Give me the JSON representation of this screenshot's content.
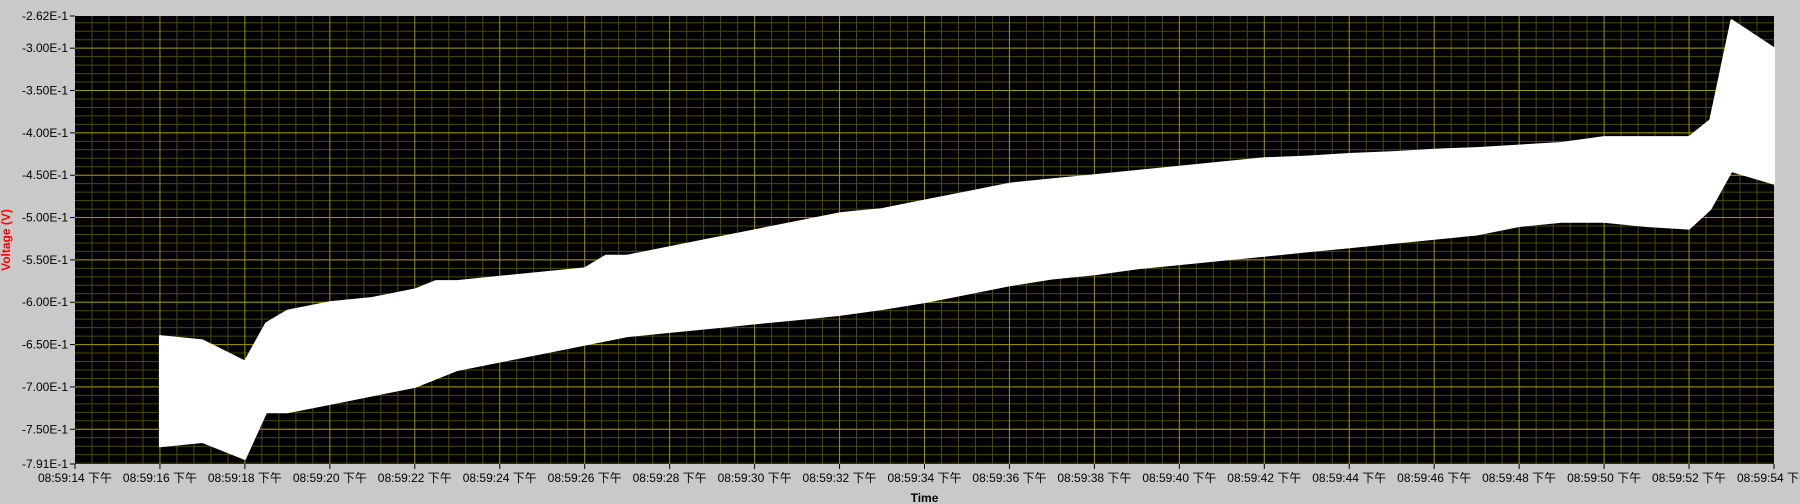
{
  "chart_data": {
    "type": "area",
    "title": "",
    "xlabel": "Time",
    "ylabel": "Voltage (V)",
    "ylim": [
      -0.791,
      -0.262
    ],
    "y_ticks": [
      -0.262,
      -0.3,
      -0.35,
      -0.4,
      -0.45,
      -0.5,
      -0.55,
      -0.6,
      -0.65,
      -0.7,
      -0.75,
      -0.791
    ],
    "y_tick_labels": [
      "-2.62E-1",
      "-3.00E-1",
      "-3.50E-1",
      "-4.00E-1",
      "-4.50E-1",
      "-5.00E-1",
      "-5.50E-1",
      "-6.00E-1",
      "-6.50E-1",
      "-7.00E-1",
      "-7.50E-1",
      "-7.91E-1"
    ],
    "xlim": [
      "08:59:14 下午",
      "08:59:54 下午"
    ],
    "x_tick_labels": [
      "08:59:14 下午",
      "08:59:16 下午",
      "08:59:18 下午",
      "08:59:20 下午",
      "08:59:22 下午",
      "08:59:24 下午",
      "08:59:26 下午",
      "08:59:28 下午",
      "08:59:30 下午",
      "08:59:32 下午",
      "08:59:34 下午",
      "08:59:36 下午",
      "08:59:38 下午",
      "08:59:40 下午",
      "08:59:42 下午",
      "08:59:44 下午",
      "08:59:46 下午",
      "08:59:48 下午",
      "08:59:50 下午",
      "08:59:52 下午",
      "08:59:54 下午"
    ],
    "grid": true,
    "colors": {
      "plot_bg": "#000000",
      "grid_major": "#9c9500",
      "grid_minor": "#4d4a00",
      "signal": "#ffffff",
      "ylabel": "#ff0000",
      "frame_bg": "#c9c9c9"
    },
    "series": [
      {
        "x": [
          "08:59:16 下午",
          "08:59:17 下午",
          "08:59:18 下午",
          "08:59:18.5 下午",
          "08:59:19 下午",
          "08:59:20 下午",
          "08:59:21 下午",
          "08:59:22 下午",
          "08:59:22.5 下午",
          "08:59:23 下午",
          "08:59:24 下午",
          "08:59:25 下午",
          "08:59:26 下午",
          "08:59:26.5 下午",
          "08:59:27 下午",
          "08:59:28 下午",
          "08:59:29 下午",
          "08:59:30 下午",
          "08:59:31 下午",
          "08:59:32 下午",
          "08:59:33 下午",
          "08:59:34 下午",
          "08:59:35 下午",
          "08:59:36 下午",
          "08:59:37 下午",
          "08:59:38 下午",
          "08:59:39 下午",
          "08:59:40 下午",
          "08:59:41 下午",
          "08:59:42 下午",
          "08:59:43 下午",
          "08:59:44 下午",
          "08:59:45 下午",
          "08:59:46 下午",
          "08:59:47 下午",
          "08:59:48 下午",
          "08:59:49 下午",
          "08:59:50 下午",
          "08:59:51 下午",
          "08:59:52 下午",
          "08:59:52.5 下午",
          "08:59:53 下午",
          "08:59:54 下午"
        ],
        "upper": [
          -0.64,
          -0.645,
          -0.67,
          -0.625,
          -0.61,
          -0.6,
          -0.595,
          -0.585,
          -0.575,
          -0.575,
          -0.57,
          -0.565,
          -0.56,
          -0.545,
          -0.545,
          -0.535,
          -0.525,
          -0.515,
          -0.505,
          -0.495,
          -0.49,
          -0.48,
          -0.47,
          -0.46,
          -0.455,
          -0.45,
          -0.445,
          -0.44,
          -0.435,
          -0.43,
          -0.428,
          -0.425,
          -0.423,
          -0.42,
          -0.418,
          -0.415,
          -0.412,
          -0.405,
          -0.405,
          -0.405,
          -0.385,
          -0.267,
          -0.3
        ],
        "lower": [
          -0.77,
          -0.765,
          -0.785,
          -0.73,
          -0.73,
          -0.72,
          -0.71,
          -0.7,
          -0.69,
          -0.68,
          -0.67,
          -0.66,
          -0.65,
          -0.645,
          -0.64,
          -0.635,
          -0.63,
          -0.625,
          -0.62,
          -0.615,
          -0.608,
          -0.6,
          -0.59,
          -0.58,
          -0.572,
          -0.567,
          -0.56,
          -0.555,
          -0.55,
          -0.545,
          -0.54,
          -0.535,
          -0.53,
          -0.525,
          -0.52,
          -0.51,
          -0.505,
          -0.505,
          -0.51,
          -0.513,
          -0.49,
          -0.445,
          -0.46
        ]
      }
    ]
  }
}
